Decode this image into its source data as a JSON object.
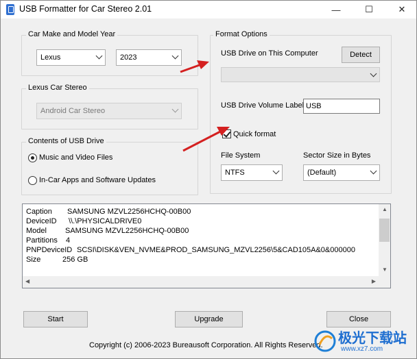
{
  "window": {
    "title": "USB Formatter for Car Stereo 2.01",
    "minimize": "—",
    "maximize": "☐",
    "close": "✕"
  },
  "car": {
    "group_title": "Car Make and Model Year",
    "make": "Lexus",
    "year": "2023"
  },
  "stereo": {
    "group_title": "Lexus Car Stereo",
    "value": "Android Car Stereo"
  },
  "contents": {
    "group_title": "Contents of USB Drive",
    "option_music": "Music and Video Files",
    "option_apps": "In-Car Apps and Software Updates",
    "selected": "music"
  },
  "format": {
    "group_title": "Format Options",
    "drive_label": "USB Drive on This Computer",
    "detect_button": "Detect",
    "drive_value": "",
    "volume_label_caption": "USB Drive Volume Label",
    "volume_label_value": "USB",
    "quick_format": "Quick format",
    "quick_format_checked": true,
    "file_system_caption": "File System",
    "file_system_value": "NTFS",
    "sector_caption": "Sector Size in Bytes",
    "sector_value": "(Default)"
  },
  "drive_info": [
    {
      "key": "Caption",
      "value": "SAMSUNG MZVL2256HCHQ-00B00"
    },
    {
      "key": "DeviceID",
      "value": "\\\\.\\PHYSICALDRIVE0"
    },
    {
      "key": "Model",
      "value": "SAMSUNG MZVL2256HCHQ-00B00"
    },
    {
      "key": "Partitions",
      "value": "4"
    },
    {
      "key": "PNPDeviceID",
      "value": "SCSI\\DISK&VEN_NVME&PROD_SAMSUNG_MZVL2256\\5&CAD105A&0&000000"
    },
    {
      "key": "Size",
      "value": "256 GB"
    }
  ],
  "buttons": {
    "start": "Start",
    "upgrade": "Upgrade",
    "close": "Close"
  },
  "footer": {
    "copyright": "Copyright (c) 2006-2023 Bureausoft Corporation. All Rights Reserved."
  },
  "watermark": {
    "text": "极光下载站",
    "url": "www.xz7.com"
  },
  "colors": {
    "arrow": "#d42020",
    "background": "#f0f0f0"
  }
}
